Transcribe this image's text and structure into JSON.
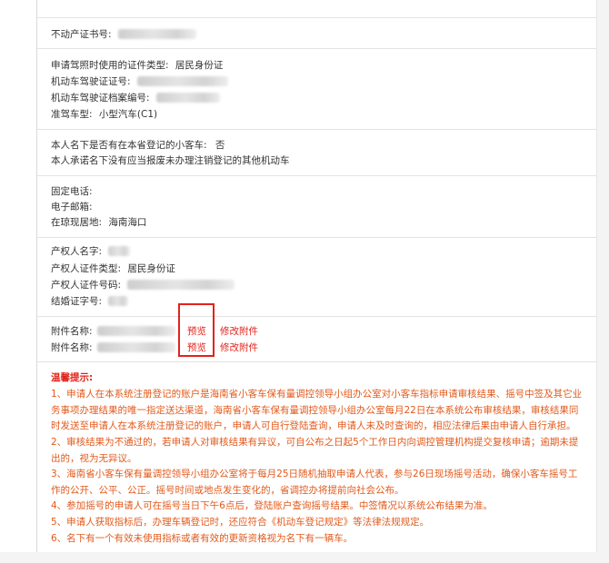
{
  "section_property_no": {
    "label": "不动产证书号:"
  },
  "section_license": {
    "id_type_label": "申请驾照时使用的证件类型:",
    "id_type_value": "居民身份证",
    "license_no_label": "机动车驾驶证证号:",
    "archive_no_label": "机动车驾驶证档案编号:",
    "vehicle_class_label": "准驾车型:",
    "vehicle_class_value": "小型汽车(C1)"
  },
  "section_cars": {
    "has_car_label": "本人名下是否有在本省登记的小客车:",
    "has_car_value": "否",
    "pledge_text": "本人承诺名下没有应当报废未办理注销登记的其他机动车"
  },
  "section_contact": {
    "phone_label": "固定电话:",
    "email_label": "电子邮箱:",
    "residence_label": "在琼现居地:",
    "residence_value": "海南海口"
  },
  "section_owner": {
    "owner_name_label": "产权人名字:",
    "owner_id_type_label": "产权人证件类型:",
    "owner_id_type_value": "居民身份证",
    "owner_id_no_label": "产权人证件号码:",
    "marriage_cert_label": "结婚证字号:"
  },
  "attachments": [
    {
      "label": "附件名称:",
      "preview": "预览",
      "modify": "修改附件"
    },
    {
      "label": "附件名称:",
      "preview": "预览",
      "modify": "修改附件"
    }
  ],
  "tips": {
    "title": "温馨提示:",
    "items": [
      "1、申请人在本系统注册登记的账户是海南省小客车保有量调控领导小组办公室对小客车指标申请审核结果、摇号中签及其它业务事项办理结果的唯一指定送达渠道，海南省小客车保有量调控领导小组办公室每月22日在本系统公布审核结果，审核结果同时发送至申请人在本系统注册登记的账户，申请人可自行登陆查询，申请人未及时查询的，相应法律后果由申请人自行承担。",
      "2、审核结果为不通过的，若申请人对审核结果有异议，可自公布之日起5个工作日内向调控管理机构提交复核申请；逾期未提出的，视为无异议。",
      "3、海南省小客车保有量调控领导小组办公室将于每月25日随机抽取申请人代表，参与26日现场摇号活动，确保小客车摇号工作的公开、公平、公正。摇号时间或地点发生变化的，省调控办将提前向社会公布。",
      "4、参加摇号的申请人可在摇号当日下午6点后，登陆账户查询摇号结果。中签情况以系统公布结果为准。",
      "5、申请人获取指标后，办理车辆登记时，还应符合《机动车登记规定》等法律法规规定。",
      "6、名下有一个有效未使用指标或者有效的更新资格视为名下有一辆车。"
    ]
  }
}
